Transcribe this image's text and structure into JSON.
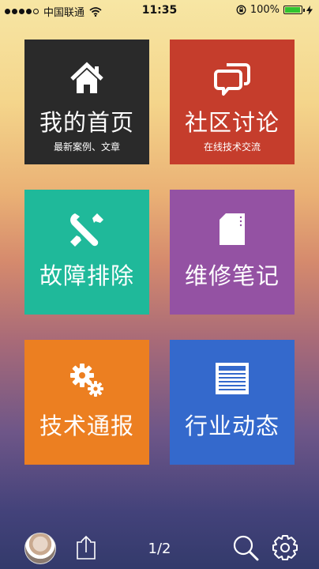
{
  "status_bar": {
    "carrier": "中国联通",
    "time": "11:35",
    "battery": "100%"
  },
  "tiles": {
    "home": {
      "title": "我的首页",
      "subtitle": "最新案例、文章"
    },
    "forum": {
      "title": "社区讨论",
      "subtitle": "在线技术交流"
    },
    "trouble": {
      "title": "故障排除"
    },
    "notes": {
      "title": "维修笔记"
    },
    "bulletin": {
      "title": "技术通报"
    },
    "news": {
      "title": "行业动态"
    }
  },
  "bottom_bar": {
    "page_indicator": "1/2"
  }
}
